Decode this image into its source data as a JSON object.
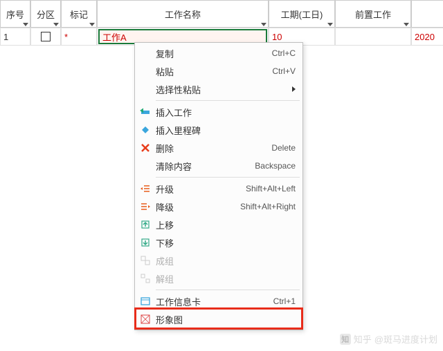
{
  "headers": {
    "seq": "序号",
    "partition": "分区",
    "mark": "标记",
    "name": "工作名称",
    "duration": "工期(工日)",
    "predecessor": "前置工作"
  },
  "row": {
    "seq": "1",
    "mark": "*",
    "name": "工作A",
    "duration": "10",
    "rest": "2020"
  },
  "menu": {
    "copy": {
      "label": "复制",
      "shortcut": "Ctrl+C"
    },
    "paste": {
      "label": "粘贴",
      "shortcut": "Ctrl+V"
    },
    "paste_special": {
      "label": "选择性粘贴"
    },
    "insert_task": {
      "label": "插入工作"
    },
    "insert_milestone": {
      "label": "插入里程碑"
    },
    "delete": {
      "label": "删除",
      "shortcut": "Delete"
    },
    "clear": {
      "label": "清除内容",
      "shortcut": "Backspace"
    },
    "outdent": {
      "label": "升级",
      "shortcut": "Shift+Alt+Left"
    },
    "indent": {
      "label": "降级",
      "shortcut": "Shift+Alt+Right"
    },
    "move_up": {
      "label": "上移"
    },
    "move_down": {
      "label": "下移"
    },
    "group": {
      "label": "成组"
    },
    "ungroup": {
      "label": "解组"
    },
    "info_card": {
      "label": "工作信息卡",
      "shortcut": "Ctrl+1"
    },
    "shape": {
      "label": "形象图"
    }
  },
  "watermark": {
    "site": "知乎",
    "author": "@斑马进度计划"
  }
}
